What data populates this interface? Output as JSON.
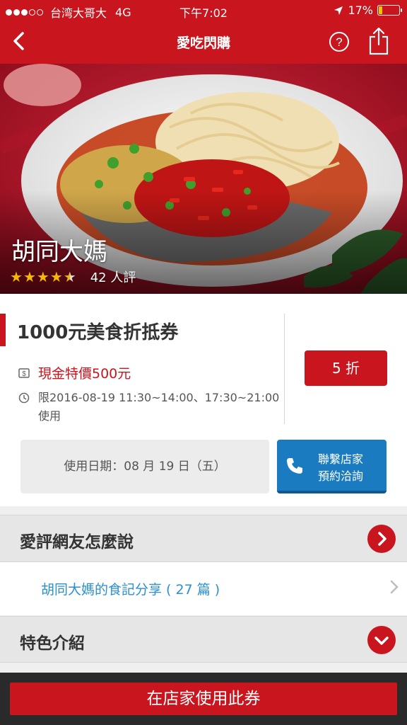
{
  "status_bar": {
    "carrier": "台湾大哥大",
    "network": "4G",
    "time": "下午7:02",
    "battery_percent": "17%",
    "battery_level": 0.17,
    "battery_color": "#f5c400"
  },
  "nav": {
    "title": "愛吃閃購",
    "back_icon": "chevron-left-icon",
    "help_icon": "question-circle-icon",
    "share_icon": "share-icon"
  },
  "hero": {
    "restaurant_name": "胡同大媽",
    "rating": 4.5,
    "rating_max": 5,
    "review_count_text": "42 人評"
  },
  "deal": {
    "title": "1000元美食折抵券",
    "price_text": "現金特價500元",
    "valid_time_text": "限2016-08-19 11:30~14:00、17:30~21:00 使用",
    "discount_label": "5 折",
    "use_date_text": "使用日期：08 月 19 日（五）",
    "contact_line1": "聯繫店家",
    "contact_line2": "預約洽詢"
  },
  "reviews_section": {
    "label": "愛評網友怎麼說",
    "link_text": "胡同大媽的食記分享 ( 27 篇 )"
  },
  "intro_section": {
    "label": "特色介紹"
  },
  "cta": {
    "label": "在店家使用此券"
  },
  "colors": {
    "brand_red": "#c9151e",
    "link_blue": "#2b8fd0",
    "call_blue": "#1a7bc1",
    "star_gold": "#f6b800"
  }
}
